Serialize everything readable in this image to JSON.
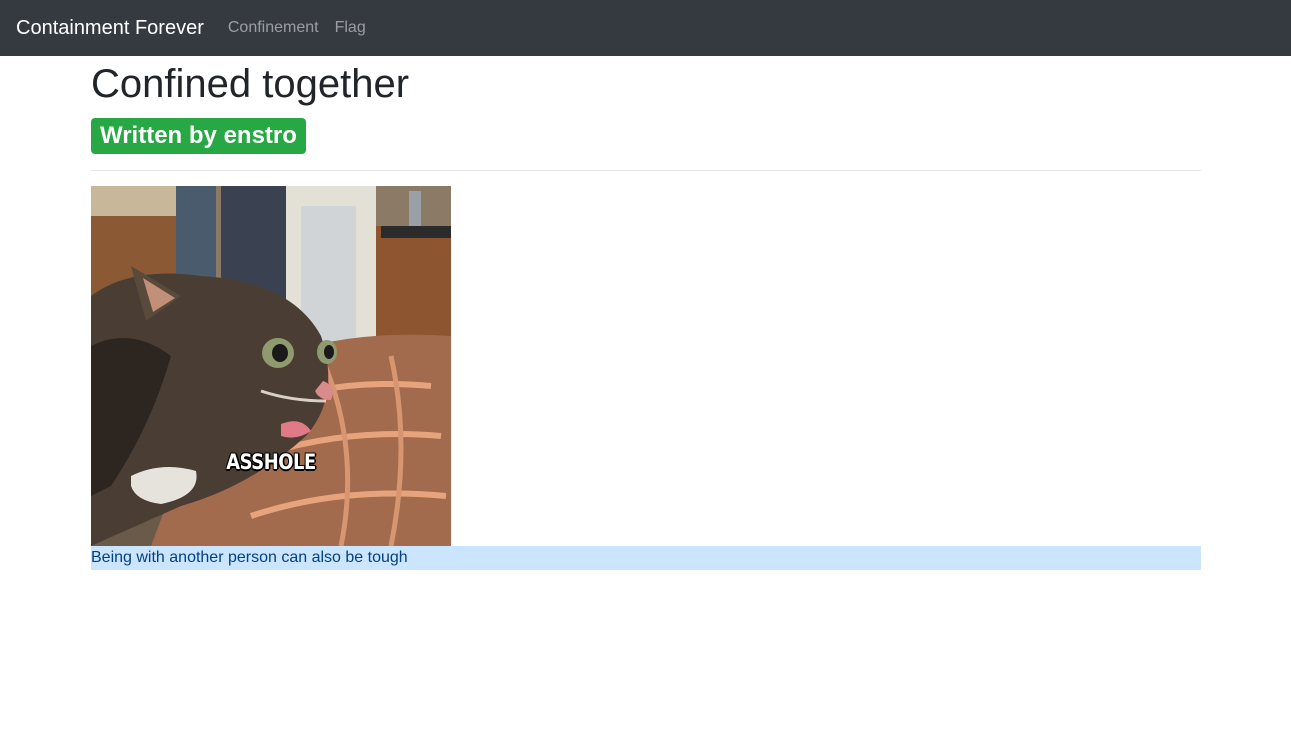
{
  "navbar": {
    "brand": "Containment Forever",
    "links": [
      "Confinement",
      "Flag"
    ]
  },
  "post": {
    "title": "Confined together",
    "author_badge": "Written by enstro",
    "image": {
      "overlay_text": "ASSHOLE"
    },
    "caption": "Being with another person can also be tough"
  },
  "colors": {
    "navbar_bg": "#343a40",
    "badge_bg": "#28a745",
    "caption_bg": "#cce5ff",
    "caption_text": "#004085"
  }
}
